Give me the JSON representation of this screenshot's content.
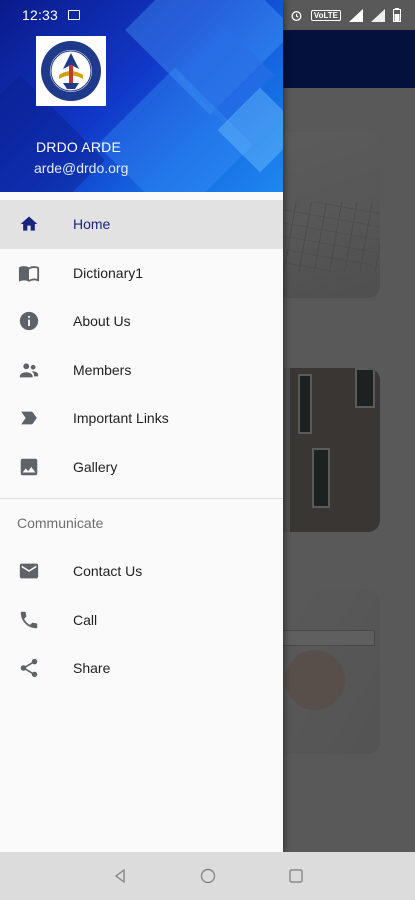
{
  "status_bar": {
    "time": "12:33",
    "network_label": "VoLTE"
  },
  "drawer": {
    "header": {
      "logo_label": "DRDO",
      "user_name": "DRDO ARDE",
      "user_email": "arde@drdo.org"
    },
    "primary_items": [
      {
        "label": "Home",
        "icon": "home-icon",
        "active": true
      },
      {
        "label": "Dictionary1",
        "icon": "book-icon",
        "active": false
      },
      {
        "label": "About Us",
        "icon": "info-icon",
        "active": false
      },
      {
        "label": "Members",
        "icon": "people-icon",
        "active": false
      },
      {
        "label": "Important Links",
        "icon": "label-icon",
        "active": false
      },
      {
        "label": "Gallery",
        "icon": "image-icon",
        "active": false
      }
    ],
    "section_title": "Communicate",
    "secondary_items": [
      {
        "label": "Contact Us",
        "icon": "mail-icon"
      },
      {
        "label": "Call",
        "icon": "phone-icon"
      },
      {
        "label": "Share",
        "icon": "share-icon"
      }
    ]
  },
  "colors": {
    "header_gradient_start": "#0a1a8a",
    "header_gradient_end": "#1e88f0",
    "active_label": "#1a237e",
    "icon_gray": "#5f6368"
  }
}
